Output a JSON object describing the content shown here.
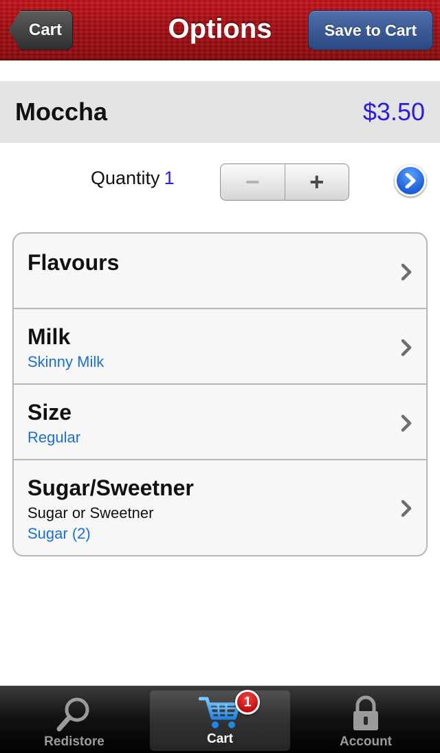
{
  "navbar": {
    "title": "Options",
    "back_label": "Cart",
    "save_label": "Save to Cart"
  },
  "item": {
    "name": "Moccha",
    "price": "$3.50"
  },
  "quantity": {
    "label": "Quantity",
    "value": "1",
    "minus": "−",
    "plus": "+"
  },
  "options": [
    {
      "title": "Flavours",
      "description": "",
      "selected": ""
    },
    {
      "title": "Milk",
      "description": "",
      "selected": "Skinny Milk"
    },
    {
      "title": "Size",
      "description": "",
      "selected": "Regular"
    },
    {
      "title": "Sugar/Sweetner",
      "description": "Sugar or Sweetner",
      "selected": "Sugar (2)"
    }
  ],
  "tabbar": {
    "tabs": [
      {
        "label": "Redistore",
        "icon": "magnifier-icon"
      },
      {
        "label": "Cart",
        "icon": "cart-icon"
      },
      {
        "label": "Account",
        "icon": "lock-icon"
      }
    ],
    "cart_badge": "1"
  },
  "colors": {
    "nav_red": "#b01016",
    "price_blue": "#2a1de0",
    "selected_blue": "#1a6fd0"
  }
}
